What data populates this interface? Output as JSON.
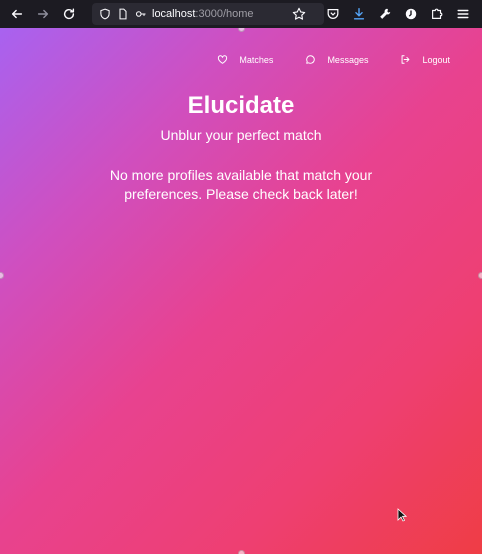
{
  "browser": {
    "url_host": "localhost",
    "url_path": ":3000/home"
  },
  "nav": {
    "matches_label": "Matches",
    "messages_label": "Messages",
    "logout_label": "Logout"
  },
  "main": {
    "title": "Elucidate",
    "subtitle": "Unblur your perfect match",
    "empty_message": "No more profiles available that match your preferences. Please check back later!"
  },
  "colors": {
    "gradient_start": "#a862f0",
    "gradient_mid": "#e8428f",
    "gradient_end": "#ef3d45",
    "toolbar_bg": "#1c1b22"
  }
}
